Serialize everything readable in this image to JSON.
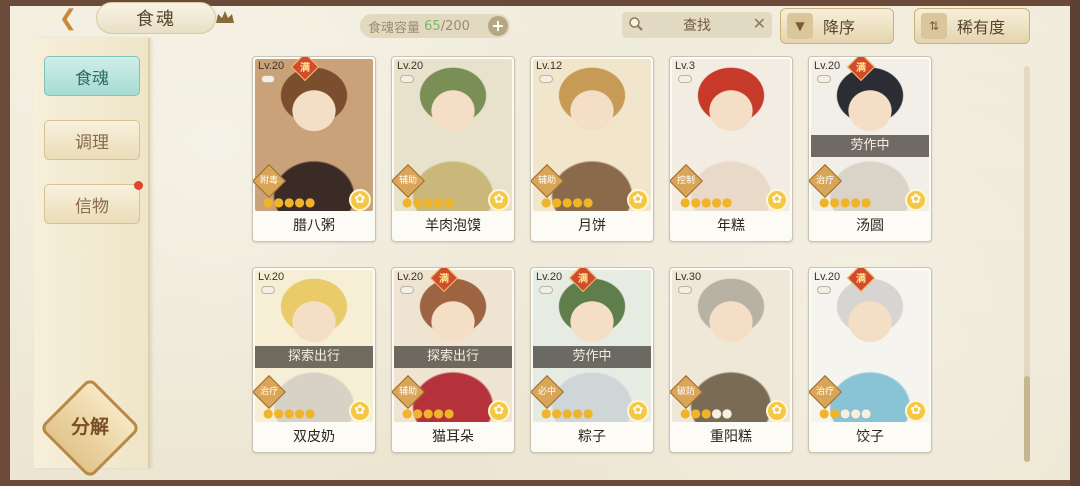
{
  "header": {
    "title": "食魂",
    "capacity_label": "食魂容量",
    "capacity_current": "65",
    "capacity_total": "/200",
    "search_label": "查找",
    "sort_order_label": "降序",
    "sort_by_label": "稀有度"
  },
  "sidebar": {
    "items": [
      {
        "label": "食魂",
        "active": true
      },
      {
        "label": "调理",
        "active": false
      },
      {
        "label": "信物",
        "active": false,
        "badge": true
      }
    ],
    "decompose_label": "分解"
  },
  "cards": [
    {
      "level": "Lv.20",
      "maxed": true,
      "role": "附毒",
      "stars": 5,
      "name": "腊八粥",
      "status": "",
      "palette": [
        "#caa27a",
        "#7b4e2e",
        "#3a2b27"
      ]
    },
    {
      "level": "Lv.20",
      "maxed": false,
      "role": "辅助",
      "stars": 5,
      "name": "羊肉泡馍",
      "status": "",
      "palette": [
        "#e8e2cc",
        "#7a8f55",
        "#c9b87a"
      ]
    },
    {
      "level": "Lv.12",
      "maxed": false,
      "role": "辅助",
      "stars": 5,
      "name": "月饼",
      "status": "",
      "palette": [
        "#f1e6cc",
        "#c79a55",
        "#8a6a4a"
      ]
    },
    {
      "level": "Lv.3",
      "maxed": false,
      "role": "控制",
      "stars": 5,
      "name": "年糕",
      "status": "",
      "palette": [
        "#f3ece2",
        "#c73a2a",
        "#e9d9c8"
      ]
    },
    {
      "level": "Lv.20",
      "maxed": true,
      "role": "治疗",
      "stars": 5,
      "name": "汤圆",
      "status": "劳作中",
      "palette": [
        "#f2efe8",
        "#2c2c35",
        "#d9d3c8"
      ]
    },
    {
      "level": "Lv.20",
      "maxed": false,
      "role": "治疗",
      "stars": 5,
      "name": "双皮奶",
      "status": "探索出行",
      "palette": [
        "#f6efd6",
        "#e9cb6a",
        "#d8d2c6"
      ]
    },
    {
      "level": "Lv.20",
      "maxed": true,
      "role": "辅助",
      "stars": 5,
      "name": "猫耳朵",
      "status": "探索出行",
      "palette": [
        "#efe4d2",
        "#9c6440",
        "#b5323a"
      ]
    },
    {
      "level": "Lv.20",
      "maxed": true,
      "role": "必中",
      "stars": 5,
      "name": "粽子",
      "status": "劳作中",
      "palette": [
        "#e6ece2",
        "#5f7e4c",
        "#cfd6d8"
      ]
    },
    {
      "level": "Lv.30",
      "maxed": false,
      "role": "破防",
      "stars": 3,
      "name": "重阳糕",
      "status": "",
      "palette": [
        "#efe8d8",
        "#b8b2a4",
        "#7a6b55"
      ]
    },
    {
      "level": "Lv.20",
      "maxed": true,
      "role": "治疗",
      "stars": 2,
      "name": "饺子",
      "status": "",
      "palette": [
        "#f6f4ef",
        "#d7d5d2",
        "#88c3d6"
      ]
    }
  ],
  "labels": {
    "maxed_badge": "满"
  }
}
